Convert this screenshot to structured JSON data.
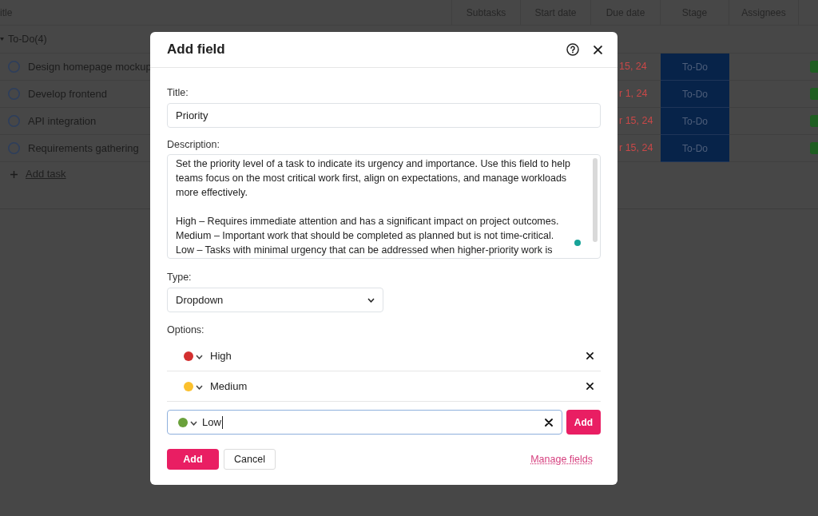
{
  "table": {
    "columns": [
      "itle",
      "Subtasks",
      "Start date",
      "Due date",
      "Stage",
      "Assignees"
    ],
    "group": {
      "label": "To-Do(4)",
      "expanded": true
    },
    "tasks": [
      {
        "title": "Design homepage mockup",
        "checked": false,
        "due": "15, 24",
        "stage": "To-Do"
      },
      {
        "title": "Develop frontend",
        "checked": false,
        "due": "r 1, 24",
        "stage": "To-Do"
      },
      {
        "title": "API integration",
        "checked": false,
        "due": "r 15, 24",
        "stage": "To-Do"
      },
      {
        "title": "Requirements gathering",
        "checked": false,
        "due": "r 15, 24",
        "stage": "To-Do"
      }
    ],
    "add_task": "Add task"
  },
  "dialog": {
    "title": "Add field",
    "title_field": {
      "label": "Title:",
      "value": "Priority"
    },
    "description_field": {
      "label": "Description:",
      "value": "Set the priority level of a task to indicate its urgency and importance. Use this field to help teams focus on the most critical work first, align on expectations, and manage workloads more effectively.\n\nHigh – Requires immediate attention and has a significant impact on project outcomes.\nMedium – Important work that should be completed as planned but is not time-critical.\nLow – Tasks with minimal urgency that can be addressed when higher-priority work is"
    },
    "type_field": {
      "label": "Type:",
      "value": "Dropdown"
    },
    "options_label": "Options:",
    "options": [
      {
        "label": "High",
        "color": "#d32f2f"
      },
      {
        "label": "Medium",
        "color": "#fbc02d"
      }
    ],
    "new_option": {
      "value": "Low",
      "color": "#6aa13b",
      "focused": true,
      "button": "Add"
    },
    "buttons": [
      {
        "label": "Add",
        "kind": "primary"
      },
      {
        "label": "Cancel",
        "kind": "secondary"
      }
    ],
    "link": "Manage fields"
  }
}
